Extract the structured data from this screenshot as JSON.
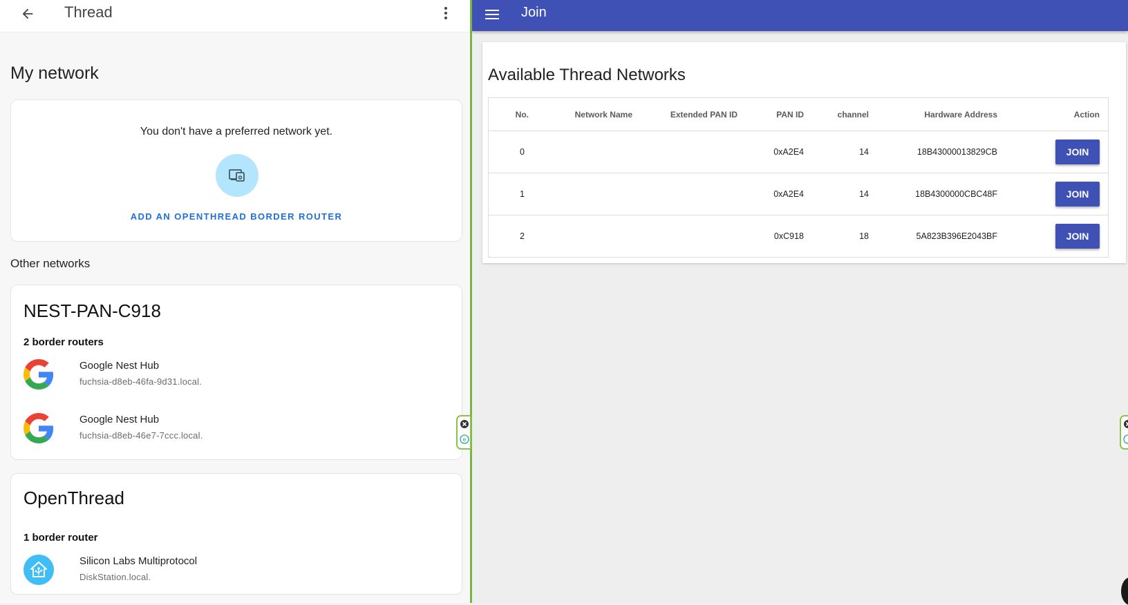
{
  "left": {
    "toolbar": {
      "title": "Thread"
    },
    "my_network_heading": "My network",
    "preferred": {
      "empty_text": "You don't have a preferred network yet.",
      "add_link": "ADD AN OPENTHREAD BORDER ROUTER"
    },
    "other_networks_heading": "Other networks",
    "networks": [
      {
        "name": "NEST-PAN-C918",
        "router_count": "2 border routers",
        "routers": [
          {
            "name": "Google Nest Hub",
            "host": "fuchsia-d8eb-46fa-9d31.local.",
            "icon": "google-icon"
          },
          {
            "name": "Google Nest Hub",
            "host": "fuchsia-d8eb-46e7-7ccc.local.",
            "icon": "google-icon"
          }
        ]
      },
      {
        "name": "OpenThread",
        "router_count": "1 border router",
        "routers": [
          {
            "name": "Silicon Labs Multiprotocol",
            "host": "DiskStation.local.",
            "icon": "home-assistant-icon"
          }
        ]
      }
    ]
  },
  "right": {
    "appbar": {
      "title": "Join"
    },
    "card_title": "Available Thread Networks",
    "table": {
      "headers": [
        "No.",
        "Network Name",
        "Extended PAN ID",
        "PAN ID",
        "channel",
        "Hardware Address",
        "Action"
      ],
      "rows": [
        {
          "no": "0",
          "network_name": "",
          "ext_pan_id": "",
          "pan_id": "0xA2E4",
          "channel": "14",
          "hw_addr": "18B43000013829CB",
          "action": "JOIN"
        },
        {
          "no": "1",
          "network_name": "",
          "ext_pan_id": "",
          "pan_id": "0xA2E4",
          "channel": "14",
          "hw_addr": "18B4300000CBC48F",
          "action": "JOIN"
        },
        {
          "no": "2",
          "network_name": "",
          "ext_pan_id": "",
          "pan_id": "0xC918",
          "channel": "18",
          "hw_addr": "5A823B396E2043BF",
          "action": "JOIN"
        }
      ]
    }
  },
  "colors": {
    "appbar": "#3f51b5",
    "link_blue": "#1e6fd8",
    "pref_circle": "#b3e5fc",
    "divider_green": "#7cb342"
  }
}
